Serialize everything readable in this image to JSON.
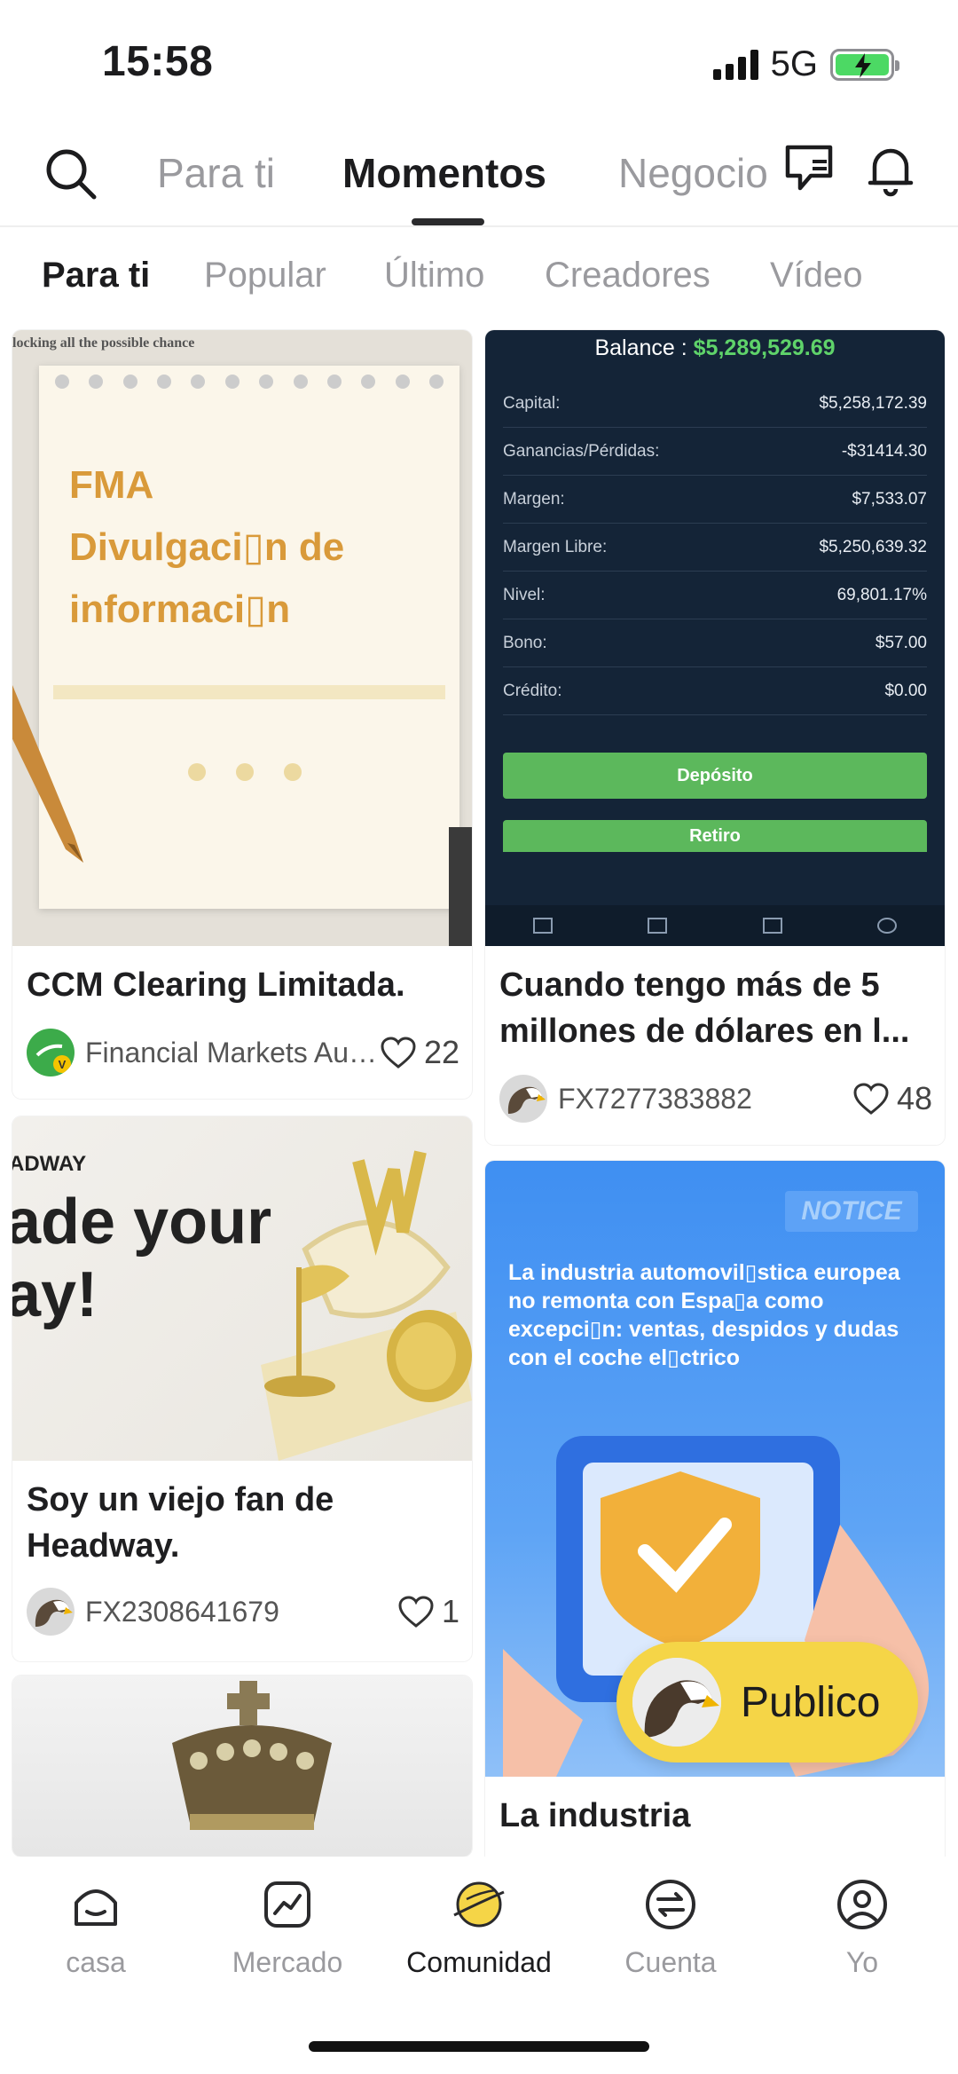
{
  "status_bar": {
    "time": "15:58",
    "network": "5G"
  },
  "top_tabs": [
    {
      "label": "Para ti",
      "active": false
    },
    {
      "label": "Momentos",
      "active": true
    },
    {
      "label": "Negocio",
      "active": false
    }
  ],
  "sub_tabs": [
    {
      "label": "Para ti",
      "active": true
    },
    {
      "label": "Popular",
      "active": false
    },
    {
      "label": "Último",
      "active": false
    },
    {
      "label": "Creadores",
      "active": false
    },
    {
      "label": "Vídeo",
      "active": false
    }
  ],
  "cards": [
    {
      "image_text": {
        "top": "locking all the possible chance",
        "line1": "FMA",
        "line2": "Divulgaci▯n de",
        "line3": "informaci▯n"
      },
      "title": "CCM Clearing Limitada.",
      "author": "Financial Markets Aut...",
      "likes": "22"
    },
    {
      "image_text": {
        "balance_label": "Balance :",
        "balance_value": "$5,289,529.69",
        "rows": [
          {
            "k": "Capital:",
            "v": "$5,258,172.39"
          },
          {
            "k": "Ganancias/Pérdidas:",
            "v": "-$31414.30"
          },
          {
            "k": "Margen:",
            "v": "$7,533.07"
          },
          {
            "k": "Margen Libre:",
            "v": "$5,250,639.32"
          },
          {
            "k": "Nivel:",
            "v": "69,801.17%"
          },
          {
            "k": "Bono:",
            "v": "$57.00"
          },
          {
            "k": "Crédito:",
            "v": "$0.00"
          }
        ],
        "deposit": "Depósito",
        "withdraw": "Retiro"
      },
      "title": "Cuando tengo más de 5 millones de dólares en l...",
      "author": "FX7277383882",
      "likes": "48"
    },
    {
      "image_text": {
        "brand": "ADWAY",
        "line1": "ade your",
        "line2": "ay!"
      },
      "title": "Soy un viejo fan de Headway.",
      "author": "FX2308641679",
      "likes": "1"
    },
    {
      "image_text": {
        "badge": "NOTICE",
        "body": "La industria automovil▯stica europea no remonta con Espa▯a como excepci▯n: ventas, despidos y dudas con el coche el▯ctrico"
      },
      "title": "La industria",
      "author": "",
      "likes": ""
    }
  ],
  "publish_button": {
    "label": "Publico"
  },
  "bottom_nav": [
    {
      "label": "casa",
      "icon": "home-icon",
      "active": false
    },
    {
      "label": "Mercado",
      "icon": "market-chart-icon",
      "active": false
    },
    {
      "label": "Comunidad",
      "icon": "community-planet-icon",
      "active": true
    },
    {
      "label": "Cuenta",
      "icon": "account-exchange-icon",
      "active": false
    },
    {
      "label": "Yo",
      "icon": "profile-icon",
      "active": false
    }
  ],
  "colors": {
    "accent_yellow": "#f5d547",
    "green": "#5cb85c",
    "balance_bg": "#142437",
    "notice_blue": "#3b8cf0"
  }
}
